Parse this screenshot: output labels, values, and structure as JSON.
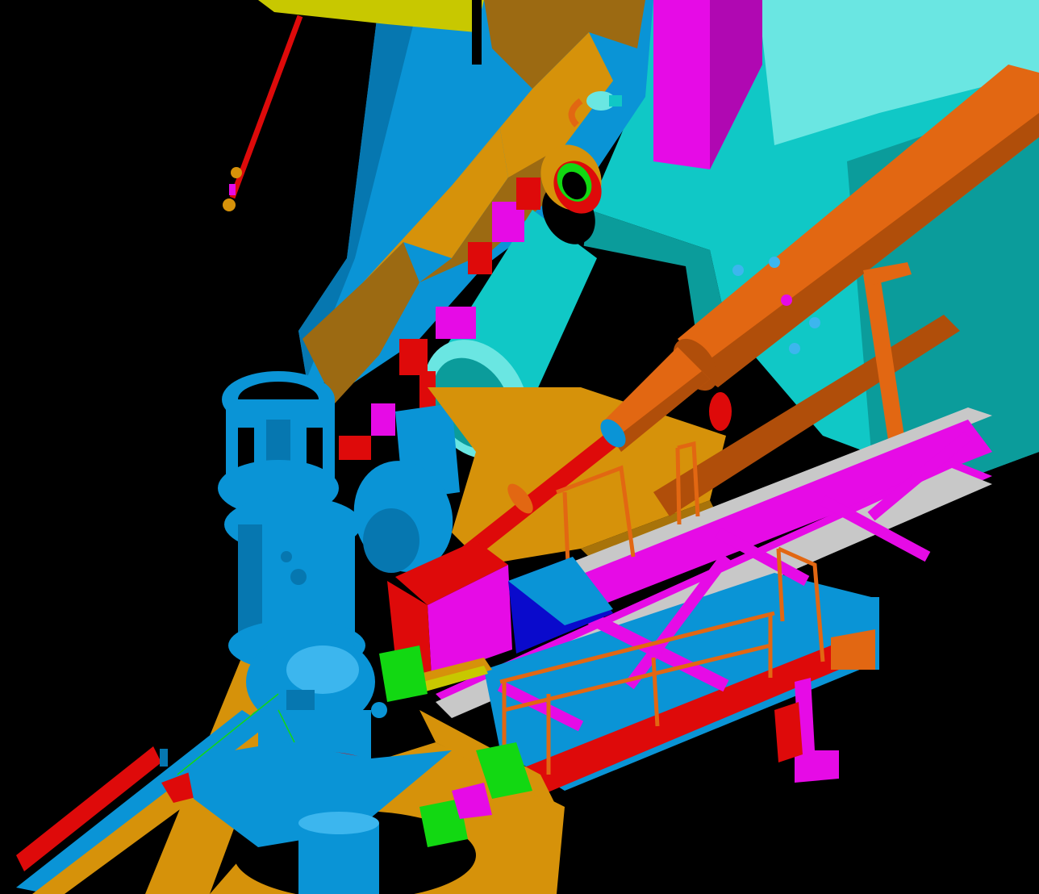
{
  "scene": {
    "background": "#000000",
    "palette": {
      "blue": "#0A94D6",
      "blue_dark": "#0677B0",
      "blue_light": "#3CB6EE",
      "cyan": "#10C8C6",
      "cyan_dark": "#0B9C9B",
      "cyan_light": "#6AE6E2",
      "gold": "#D6920A",
      "gold_dark": "#A8730A",
      "brown": "#9C6A12",
      "orange": "#E26712",
      "orange_dark": "#B04E0A",
      "magenta": "#E60BE6",
      "magenta_dark": "#B008B2",
      "red": "#DE0A0A",
      "navy": "#0A0ACC",
      "green": "#12D812",
      "yellow": "#C8C800",
      "grey": "#C8C8C8"
    }
  }
}
